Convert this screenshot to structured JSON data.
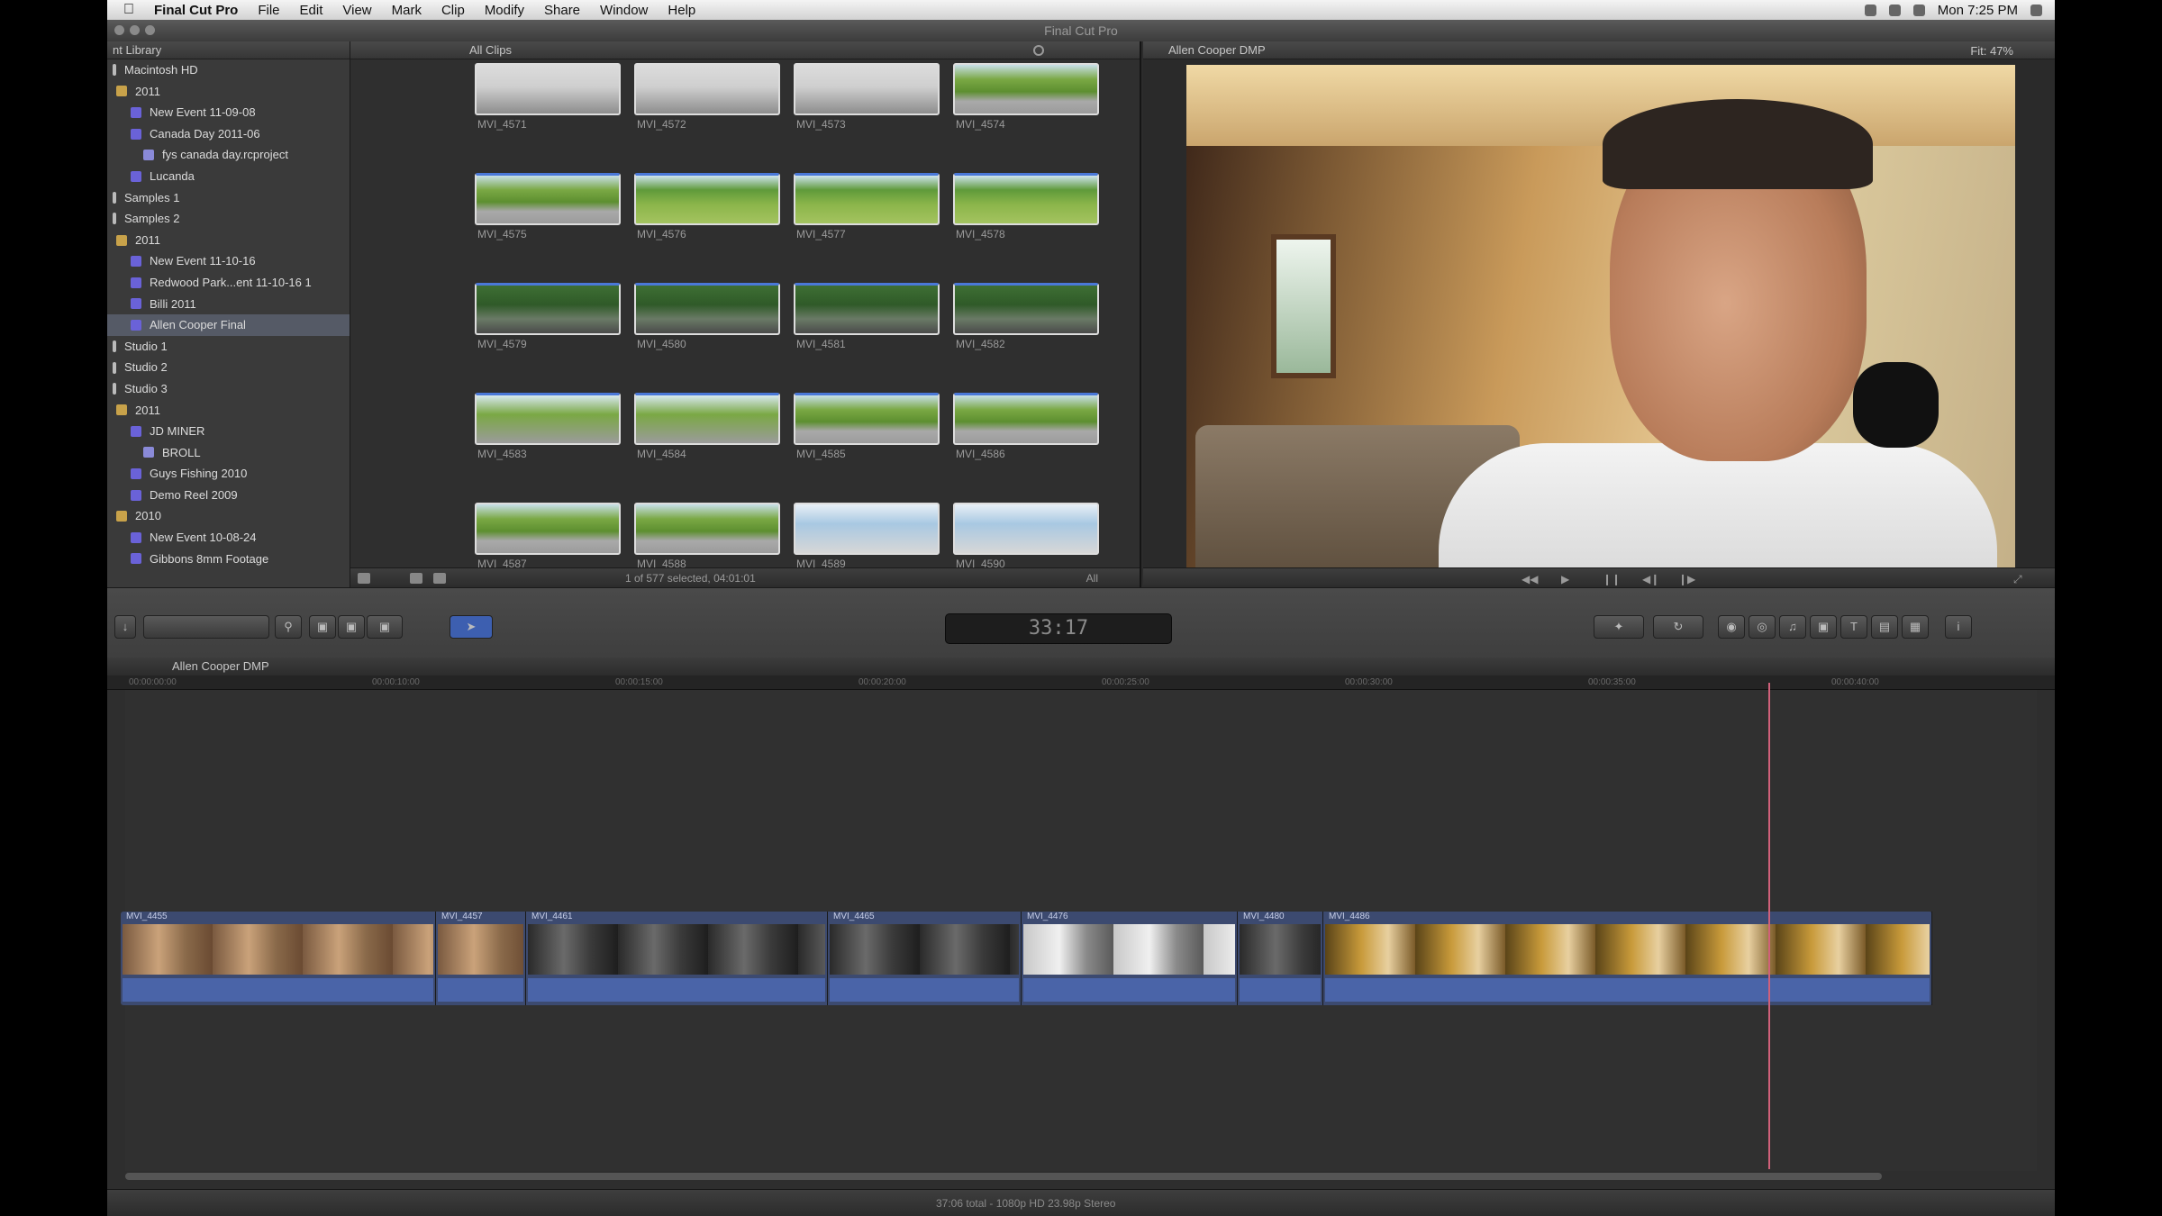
{
  "menubar": {
    "app_name": "Final Cut Pro",
    "items": [
      "File",
      "Edit",
      "View",
      "Mark",
      "Clip",
      "Modify",
      "Share",
      "Window",
      "Help"
    ],
    "clock": "Mon 7:25 PM"
  },
  "window": {
    "title": "Final Cut Pro"
  },
  "library": {
    "header": "nt Library",
    "items": [
      {
        "label": "Macintosh HD",
        "type": "disk"
      },
      {
        "label": "2011",
        "type": "folder"
      },
      {
        "label": "New Event 11-09-08",
        "type": "event"
      },
      {
        "label": "Canada Day 2011-06",
        "type": "event"
      },
      {
        "label": "fys canada day.rcproject",
        "type": "project"
      },
      {
        "label": "Lucanda",
        "type": "event"
      },
      {
        "label": "Samples 1",
        "type": "disk"
      },
      {
        "label": "Samples 2",
        "type": "disk"
      },
      {
        "label": "2011",
        "type": "folder"
      },
      {
        "label": "New Event 11-10-16",
        "type": "event"
      },
      {
        "label": "Redwood Park...ent 11-10-16 1",
        "type": "event"
      },
      {
        "label": "Billi 2011",
        "type": "event"
      },
      {
        "label": "Allen Cooper Final",
        "type": "event",
        "selected": true
      },
      {
        "label": "Studio 1",
        "type": "disk"
      },
      {
        "label": "Studio 2",
        "type": "disk"
      },
      {
        "label": "Studio 3",
        "type": "disk"
      },
      {
        "label": "2011",
        "type": "folder"
      },
      {
        "label": "JD MINER",
        "type": "event"
      },
      {
        "label": "BROLL",
        "type": "project"
      },
      {
        "label": "Guys Fishing 2010",
        "type": "event"
      },
      {
        "label": "Demo Reel 2009",
        "type": "event"
      },
      {
        "label": "2010",
        "type": "folder"
      },
      {
        "label": "New Event 10-08-24",
        "type": "event"
      },
      {
        "label": "Gibbons 8mm Footage",
        "type": "event"
      }
    ]
  },
  "browser": {
    "header": "All Clips",
    "status": "1 of 577 selected, 04:01:01",
    "filter": "All",
    "clips": [
      {
        "name": "MVI_4571",
        "style": "sky"
      },
      {
        "name": "MVI_4572",
        "style": "sky"
      },
      {
        "name": "MVI_4573",
        "style": "sky"
      },
      {
        "name": "MVI_4574",
        "style": "road"
      },
      {
        "name": "MVI_4575",
        "style": "road"
      },
      {
        "name": "MVI_4576",
        "style": "field"
      },
      {
        "name": "MVI_4577",
        "style": "field"
      },
      {
        "name": "MVI_4578",
        "style": "field"
      },
      {
        "name": "MVI_4579",
        "style": "forest"
      },
      {
        "name": "MVI_4580",
        "style": "forest"
      },
      {
        "name": "MVI_4581",
        "style": "forest"
      },
      {
        "name": "MVI_4582",
        "style": "forest"
      },
      {
        "name": "MVI_4583",
        "style": "person"
      },
      {
        "name": "MVI_4584",
        "style": "person"
      },
      {
        "name": "MVI_4585",
        "style": "road"
      },
      {
        "name": "MVI_4586",
        "style": "road"
      },
      {
        "name": "MVI_4587",
        "style": "road"
      },
      {
        "name": "MVI_4588",
        "style": "road"
      },
      {
        "name": "MVI_4589",
        "style": "sunny"
      },
      {
        "name": "MVI_4590",
        "style": "sunny"
      }
    ]
  },
  "viewer": {
    "title": "Allen Cooper DMP",
    "fit": "Fit: 47%"
  },
  "toolbar": {
    "timecode": "33:17"
  },
  "timeline": {
    "project": "Allen Cooper DMP",
    "ruler": [
      "00:00:00:00",
      "00:00:10:00",
      "00:00:15:00",
      "00:00:20:00",
      "00:00:25:00",
      "00:00:30:00",
      "00:00:35:00",
      "00:00:40:00"
    ],
    "clips": [
      {
        "label": "MVI_4455",
        "style": "warm"
      },
      {
        "label": "MVI_4457",
        "style": "warm"
      },
      {
        "label": "MVI_4461",
        "style": "dark"
      },
      {
        "label": "MVI_4465",
        "style": "dark"
      },
      {
        "label": "MVI_4476",
        "style": "light"
      },
      {
        "label": "MVI_4480",
        "style": "dark"
      },
      {
        "label": "MVI_4486",
        "style": "gold"
      }
    ],
    "info": "37:06 total - 1080p HD 23.98p Stereo"
  }
}
